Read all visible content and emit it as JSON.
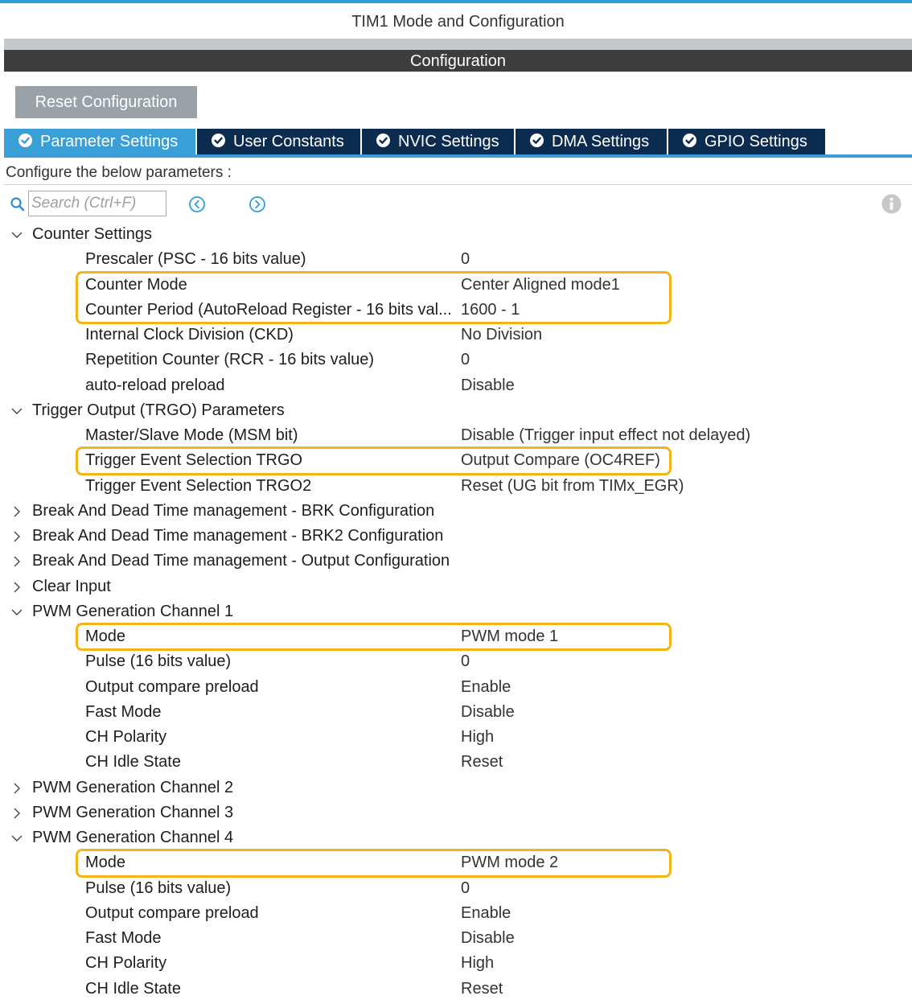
{
  "window": {
    "title": "TIM1 Mode and Configuration"
  },
  "section_header": "Configuration",
  "reset_button": "Reset Configuration",
  "tabs": [
    {
      "label": "Parameter Settings",
      "active": true
    },
    {
      "label": "User Constants",
      "active": false
    },
    {
      "label": "NVIC Settings",
      "active": false
    },
    {
      "label": "DMA Settings",
      "active": false
    },
    {
      "label": "GPIO Settings",
      "active": false
    }
  ],
  "instructions": "Configure the below parameters :",
  "search": {
    "placeholder": "Search (Ctrl+F)",
    "value": ""
  },
  "icons": [
    "search-icon",
    "previous-icon",
    "next-icon",
    "info-icon",
    "check-icon",
    "chevron-down-icon",
    "chevron-right-icon"
  ],
  "colors": {
    "accent": "#3a9fd6",
    "tab_bg": "#0b2b4f",
    "highlight": "#f2b416",
    "header_bg": "#3d3d3d"
  },
  "tree": [
    {
      "type": "group",
      "label": "Counter Settings",
      "expanded": true
    },
    {
      "type": "param",
      "label": "Prescaler (PSC - 16 bits value)",
      "value": "0"
    },
    {
      "type": "param",
      "label": "Counter Mode",
      "value": "Center Aligned mode1",
      "highlight": true
    },
    {
      "type": "param",
      "label": "Counter Period (AutoReload Register - 16 bits val...",
      "value": "1600 - 1",
      "highlight": true
    },
    {
      "type": "param",
      "label": "Internal Clock Division (CKD)",
      "value": "No Division"
    },
    {
      "type": "param",
      "label": "Repetition Counter (RCR - 16 bits value)",
      "value": "0"
    },
    {
      "type": "param",
      "label": "auto-reload preload",
      "value": "Disable"
    },
    {
      "type": "group",
      "label": "Trigger Output (TRGO) Parameters",
      "expanded": true
    },
    {
      "type": "param",
      "label": "Master/Slave Mode (MSM bit)",
      "value": "Disable (Trigger input effect not delayed)"
    },
    {
      "type": "param",
      "label": "Trigger Event Selection TRGO",
      "value": "Output Compare (OC4REF)",
      "highlight": true
    },
    {
      "type": "param",
      "label": "Trigger Event Selection TRGO2",
      "value": "Reset (UG bit from TIMx_EGR)"
    },
    {
      "type": "group",
      "label": "Break And Dead Time management - BRK Configuration",
      "expanded": false
    },
    {
      "type": "group",
      "label": "Break And Dead Time management - BRK2 Configuration",
      "expanded": false
    },
    {
      "type": "group",
      "label": "Break And Dead Time management - Output Configuration",
      "expanded": false
    },
    {
      "type": "group",
      "label": "Clear Input",
      "expanded": false
    },
    {
      "type": "group",
      "label": "PWM Generation Channel 1",
      "expanded": true
    },
    {
      "type": "param",
      "label": "Mode",
      "value": "PWM mode 1",
      "highlight": true
    },
    {
      "type": "param",
      "label": "Pulse (16 bits value)",
      "value": "0"
    },
    {
      "type": "param",
      "label": "Output compare preload",
      "value": "Enable"
    },
    {
      "type": "param",
      "label": "Fast Mode",
      "value": "Disable"
    },
    {
      "type": "param",
      "label": "CH Polarity",
      "value": "High"
    },
    {
      "type": "param",
      "label": "CH Idle State",
      "value": "Reset"
    },
    {
      "type": "group",
      "label": "PWM Generation Channel 2",
      "expanded": false
    },
    {
      "type": "group",
      "label": "PWM Generation Channel 3",
      "expanded": false
    },
    {
      "type": "group",
      "label": "PWM Generation Channel 4",
      "expanded": true
    },
    {
      "type": "param",
      "label": "Mode",
      "value": "PWM mode 2",
      "highlight": true
    },
    {
      "type": "param",
      "label": "Pulse (16 bits value)",
      "value": "0"
    },
    {
      "type": "param",
      "label": "Output compare preload",
      "value": "Enable"
    },
    {
      "type": "param",
      "label": "Fast Mode",
      "value": "Disable"
    },
    {
      "type": "param",
      "label": "CH Polarity",
      "value": "High"
    },
    {
      "type": "param",
      "label": "CH Idle State",
      "value": "Reset"
    }
  ]
}
